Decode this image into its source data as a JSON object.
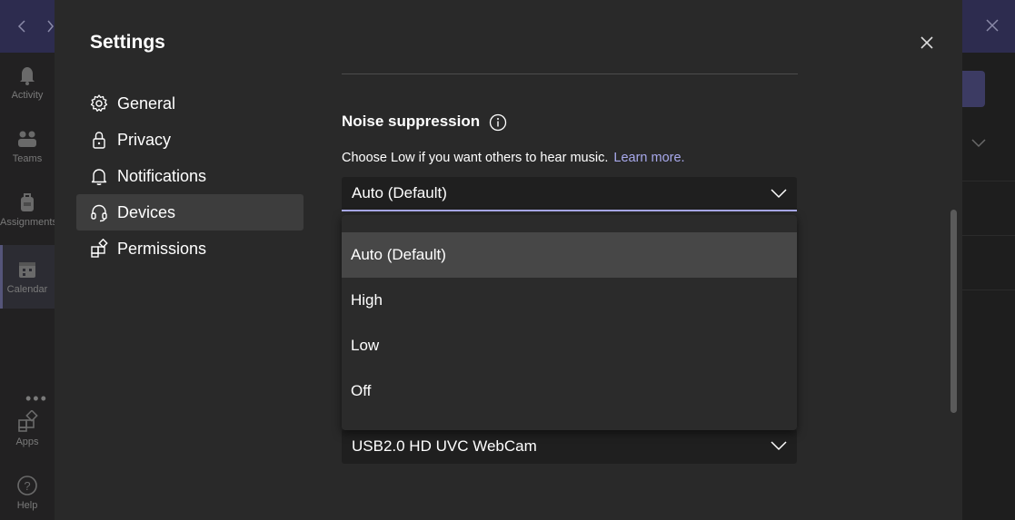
{
  "background_app": {
    "rail": [
      {
        "label": "Activity",
        "icon": "bell-icon"
      },
      {
        "label": "Teams",
        "icon": "teams-icon"
      },
      {
        "label": "Assignments",
        "icon": "backpack-icon"
      },
      {
        "label": "Calendar",
        "icon": "calendar-icon",
        "active": true
      },
      {
        "label": "Apps",
        "icon": "apps-icon"
      },
      {
        "label": "Help",
        "icon": "help-icon"
      }
    ],
    "more_label": "•••"
  },
  "settings": {
    "title": "Settings",
    "close_icon": "close-icon",
    "nav": [
      {
        "label": "General",
        "icon": "gear-icon"
      },
      {
        "label": "Privacy",
        "icon": "lock-icon"
      },
      {
        "label": "Notifications",
        "icon": "bell-icon"
      },
      {
        "label": "Devices",
        "icon": "headset-icon",
        "selected": true
      },
      {
        "label": "Permissions",
        "icon": "apps-icon"
      }
    ],
    "noise_suppression": {
      "heading": "Noise suppression",
      "description": "Choose Low if you want others to hear music.",
      "learn_more": "Learn more.",
      "selected": "Auto (Default)",
      "options": [
        "Auto (Default)",
        "High",
        "Low",
        "Off"
      ],
      "highlighted_index": 0
    },
    "camera": {
      "selected": "USB2.0 HD UVC WebCam"
    }
  },
  "colors": {
    "accent": "#a9aaea",
    "link": "#a8a9ec",
    "modal_bg": "#292929",
    "selected_nav_bg": "#3d3d3d",
    "top_bar": "#2d2c4f"
  }
}
